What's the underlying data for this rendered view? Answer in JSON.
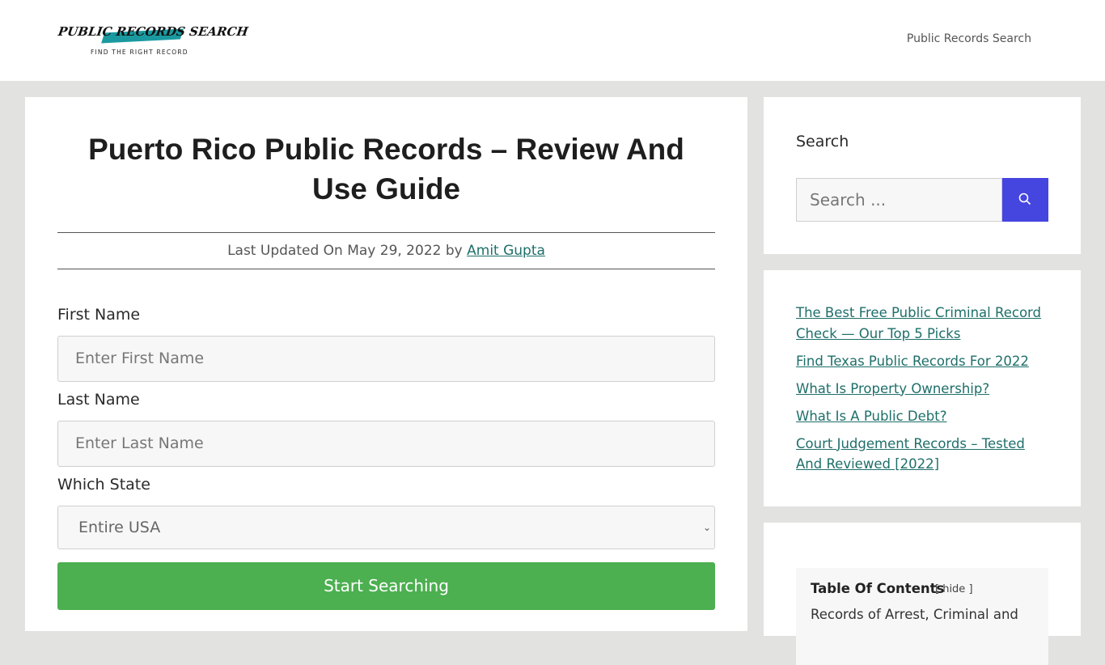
{
  "header": {
    "logo": {
      "main_text": "PUBLIC RECORDS SEARCH",
      "tagline": "FIND THE RIGHT RECORD",
      "accent_color": "#1a9aa0"
    },
    "nav": [
      {
        "label": "Public Records Search"
      }
    ]
  },
  "article": {
    "title": "Puerto Rico Public Records – Review And Use Guide",
    "meta": {
      "prefix": "Last Updated On May 29, 2022 by",
      "author": "Amit Gupta"
    },
    "form": {
      "first_name": {
        "label": "First Name",
        "placeholder": "Enter First Name",
        "value": ""
      },
      "last_name": {
        "label": "Last Name",
        "placeholder": "Enter Last Name",
        "value": ""
      },
      "state": {
        "label": "Which State",
        "selected": "Entire USA"
      },
      "submit_label": "Start Searching",
      "submit_color": "#4caf50"
    }
  },
  "sidebar": {
    "search_widget": {
      "title": "Search",
      "placeholder": "Search ...",
      "button_icon": "search-icon",
      "button_color": "#4545e0"
    },
    "recent_posts": [
      {
        "label": "The Best Free Public Criminal Record Check — Our Top 5 Picks"
      },
      {
        "label": "Find Texas Public Records For 2022"
      },
      {
        "label": "What Is Property Ownership?"
      },
      {
        "label": "What Is A Public Debt?"
      },
      {
        "label": "Court Judgement Records – Tested And Reviewed [2022]"
      }
    ],
    "toc": {
      "title": "Table Of Contents",
      "toggle_label": "[ hide ]",
      "items": [
        {
          "label": "Records of Arrest, Criminal and"
        }
      ]
    }
  }
}
